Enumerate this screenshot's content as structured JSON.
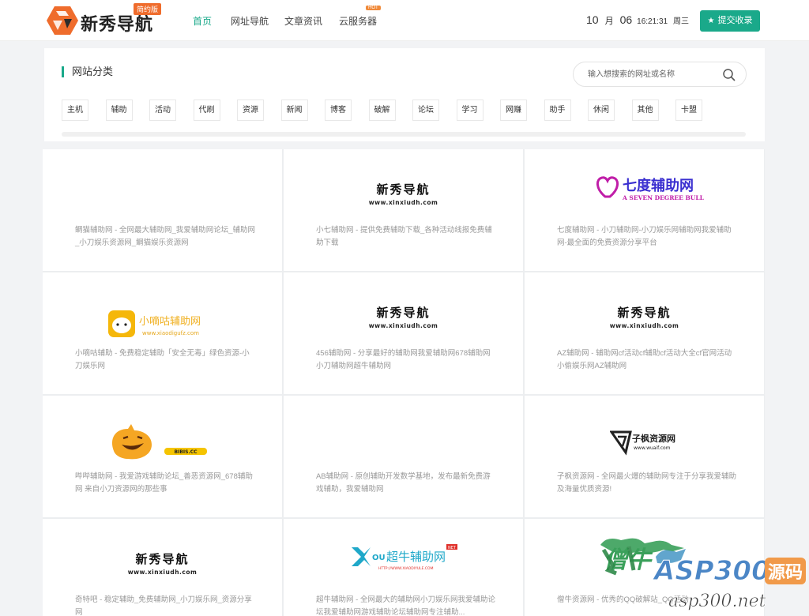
{
  "header": {
    "logo_text": "新秀导航",
    "logo_badge": "简约版",
    "nav": [
      {
        "label": "首页",
        "active": true
      },
      {
        "label": "网址导航",
        "active": false
      },
      {
        "label": "文章资讯",
        "active": false
      },
      {
        "label": "云服务器",
        "active": false
      }
    ],
    "nav_hot_badge": "HOT",
    "date": {
      "month": "10",
      "month_unit": "月",
      "day": "06",
      "time": "16:21:31",
      "weekday": "周三"
    },
    "submit_label": "提交收录"
  },
  "category": {
    "title": "网站分类",
    "search_placeholder": "输入想搜索的网址或名称",
    "tags": [
      "主机",
      "辅助",
      "活动",
      "代刷",
      "资源",
      "新闻",
      "博客",
      "破解",
      "论坛",
      "学习",
      "网赚",
      "助手",
      "休闲",
      "其他",
      "卡盟"
    ]
  },
  "sites": [
    {
      "logo_type": "none",
      "description": "鲷猫辅助网 - 全网最大辅助网_我爱辅助网论坛_辅助网_小刀娱乐资源网_鲷猫娱乐资源网"
    },
    {
      "logo_type": "xinxiu",
      "logo_title": "新秀导航",
      "logo_url": "www.xinxiudh.com",
      "description": "小七辅助网 - 提供免费辅助下载_各种活动线报免费辅助下载"
    },
    {
      "logo_type": "qidu",
      "logo_title": "七度辅助网",
      "logo_sub": "A SEVEN DEGREE BULL",
      "description": "七度辅助网 - 小刀辅助网-小刀娱乐网辅助网我爱辅助网-最全面的免费资源分享平台"
    },
    {
      "logo_type": "xiaodigu",
      "logo_title": "小嘀咕辅助网",
      "logo_url": "www.xiaodigufz.com",
      "description": "小嘀咕辅助 - 免费稳定辅助「安全无毒」绿色资源-小刀娱乐网"
    },
    {
      "logo_type": "xinxiu",
      "logo_title": "新秀导航",
      "logo_url": "www.xinxiudh.com",
      "description": "456辅助网 - 分享最好的辅助网我爱辅助网678辅助网小刀辅助网超牛辅助网"
    },
    {
      "logo_type": "xinxiu",
      "logo_title": "新秀导航",
      "logo_url": "www.xinxiudh.com",
      "description": "AZ辅助网 - 辅助网cf活动cf辅助cf活动大全cf官网活动小偷娱乐网AZ辅助网"
    },
    {
      "logo_type": "bibis",
      "logo_url": "BIBIS.CC",
      "description": "哔哔辅助网 - 我爱游戏辅助论坛_善恶资源网_678辅助网 来自小刀资源网的那些事"
    },
    {
      "logo_type": "none",
      "description": "AB辅助网 - 原创辅助开发数学基地，发布最新免费游戏辅助，我爱辅助网"
    },
    {
      "logo_type": "zifeng",
      "logo_title": "子枫资源网",
      "logo_url": "www.wuaif.com",
      "description": "子枫资源网 - 全网最火爆的辅助网专注于分享我爱辅助及海量优质资源!"
    },
    {
      "logo_type": "xinxiu",
      "logo_title": "新秀导航",
      "logo_url": "www.xinxiudh.com",
      "description": "奇特吧 - 稳定辅助_免费辅助网_小刀娱乐网_资源分享网"
    },
    {
      "logo_type": "chaoniu",
      "logo_title": "超牛辅助网",
      "logo_url": "HTTP://WWW.XIAODIYULE.COM",
      "logo_badge": "NET",
      "description": "超牛辅助网 - 全网最大的辅助网小刀娱乐网我爱辅助论坛我爱辅助网游戏辅助论坛辅助网专注辅助..."
    },
    {
      "logo_type": "sengniu",
      "logo_title": "僧牛",
      "description": "僧牛资源网 - 优秀的QQ破解站_QQ活动"
    }
  ],
  "watermark": {
    "brand": "ASP300",
    "brand_cn": "源码",
    "url": "asp300.net"
  },
  "colors": {
    "accent": "#1aa98a",
    "logo_orange": "#ef6c2c"
  }
}
